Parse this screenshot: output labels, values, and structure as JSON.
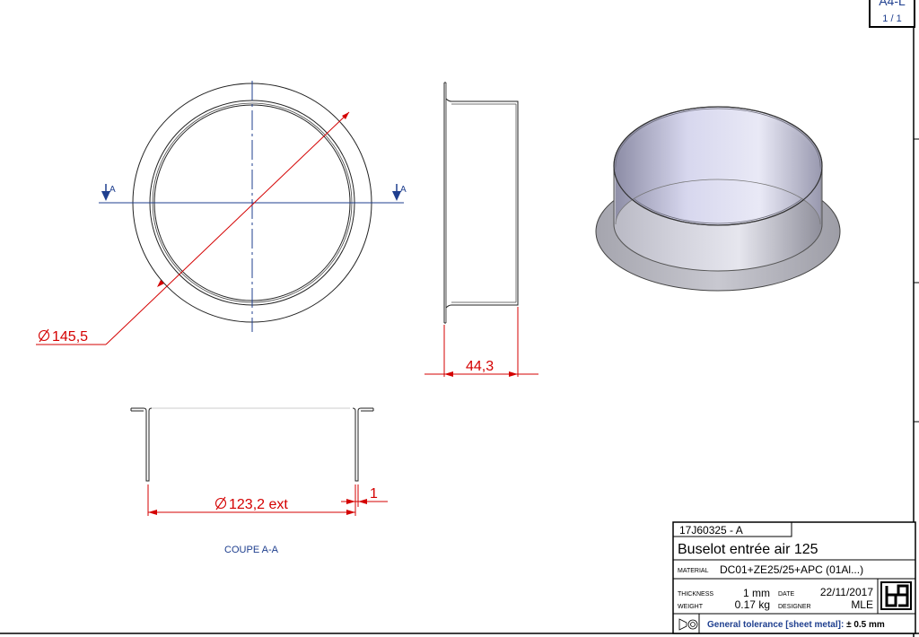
{
  "sheet": {
    "format": "A4-L",
    "page": "1 / 1"
  },
  "section": {
    "marker_left": "A",
    "marker_right": "A",
    "caption": "COUPE A-A"
  },
  "dimensions": {
    "outer_diameter": "145,5",
    "height": "44,3",
    "inner_diameter": "123,2 ext",
    "thickness": "1"
  },
  "title_block": {
    "part_number": "17J60325 - A",
    "title": "Buselot entrée air 125",
    "material_label": "MATERIAL",
    "material": "DC01+ZE25/25+APC (01Al...)",
    "thickness_label": "THICKNESS",
    "thickness": "1 mm",
    "weight_label": "WEIGHT",
    "weight": "0.17 kg",
    "date_label": "DATE",
    "date": "22/11/2017",
    "designer_label": "DESIGNER",
    "designer": "MLE",
    "logo": "bg",
    "tolerance_label": "General tolerance [sheet metal]:",
    "tolerance_value": "± 0.5 mm"
  },
  "colors": {
    "dimension": "#d40000",
    "axis": "#1f3f8f",
    "outline": "#222222"
  }
}
